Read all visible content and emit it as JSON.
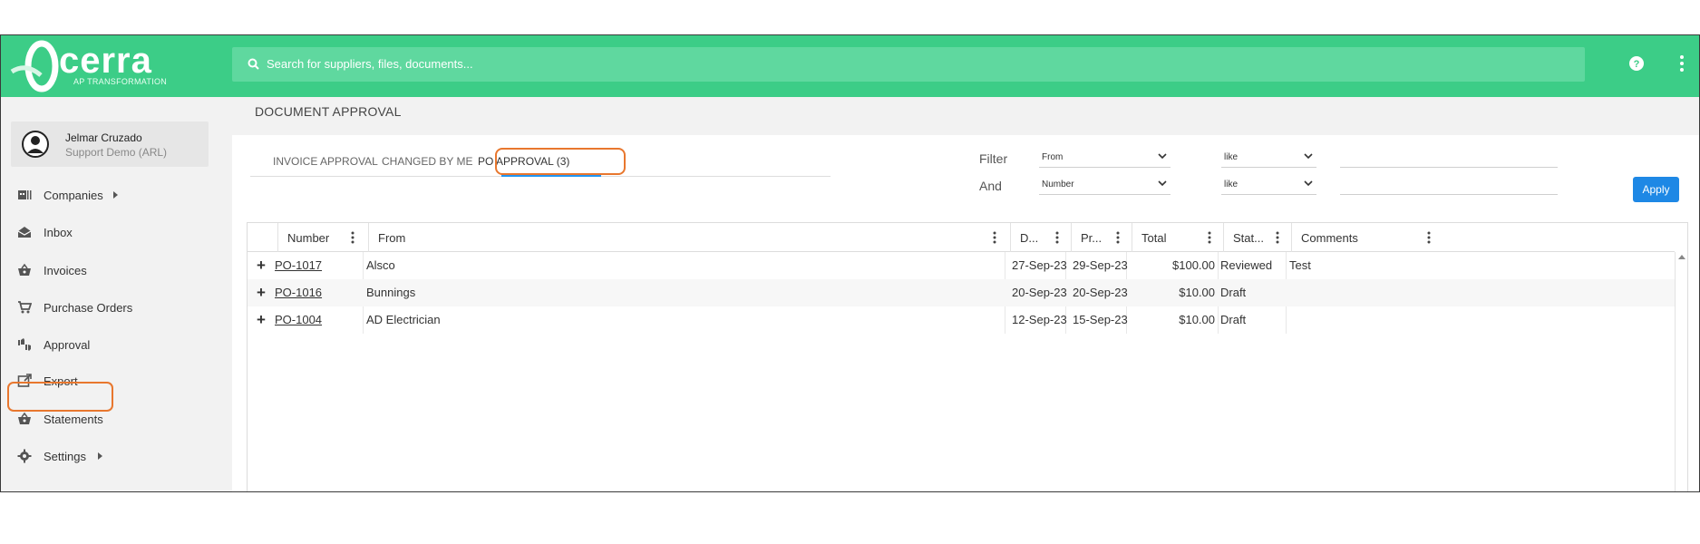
{
  "brand": {
    "name": "cerra",
    "tagline": "AP TRANSFORMATION",
    "color": "#3ccd87"
  },
  "search": {
    "placeholder": "Search for suppliers, files, documents..."
  },
  "user": {
    "name": "Jelmar Cruzado",
    "org": "Support Demo (ARL)"
  },
  "sidebar": {
    "items": [
      {
        "label": "Companies",
        "icon": "companies-icon",
        "has_submenu": true
      },
      {
        "label": "Inbox",
        "icon": "inbox-icon"
      },
      {
        "label": "Invoices",
        "icon": "invoices-basket-icon"
      },
      {
        "label": "Purchase Orders",
        "icon": "cart-icon"
      },
      {
        "label": "Approval",
        "icon": "thumbs-icon",
        "highlighted": true
      },
      {
        "label": "Export",
        "icon": "export-icon"
      },
      {
        "label": "Statements",
        "icon": "statements-basket-icon"
      },
      {
        "label": "Settings",
        "icon": "gear-icon",
        "has_submenu": true
      }
    ]
  },
  "page": {
    "title": "DOCUMENT APPROVAL"
  },
  "tabs": [
    {
      "label": "INVOICE APPROVAL"
    },
    {
      "label": "CHANGED BY ME"
    },
    {
      "label": "PO APPROVAL (3)",
      "active": true
    }
  ],
  "filter": {
    "filter_label": "Filter",
    "and_label": "And",
    "row1": {
      "field": "From",
      "op": "like",
      "value": ""
    },
    "row2": {
      "field": "Number",
      "op": "like",
      "value": ""
    },
    "apply_label": "Apply"
  },
  "grid": {
    "columns": [
      "Number",
      "From",
      "D...",
      "Pr...",
      "Total",
      "Stat...",
      "Comments"
    ],
    "rows": [
      {
        "number": "PO-1017",
        "from": "Alsco",
        "d": "27-Sep-23",
        "pr": "29-Sep-23",
        "total": "$100.00",
        "status": "Reviewed",
        "comments": "Test"
      },
      {
        "number": "PO-1016",
        "from": "Bunnings",
        "d": "20-Sep-23",
        "pr": "20-Sep-23",
        "total": "$10.00",
        "status": "Draft",
        "comments": ""
      },
      {
        "number": "PO-1004",
        "from": "AD Electrician",
        "d": "12-Sep-23",
        "pr": "15-Sep-23",
        "total": "$10.00",
        "status": "Draft",
        "comments": ""
      }
    ]
  },
  "colors": {
    "accent": "#2196f3",
    "highlight": "#e8772e"
  }
}
